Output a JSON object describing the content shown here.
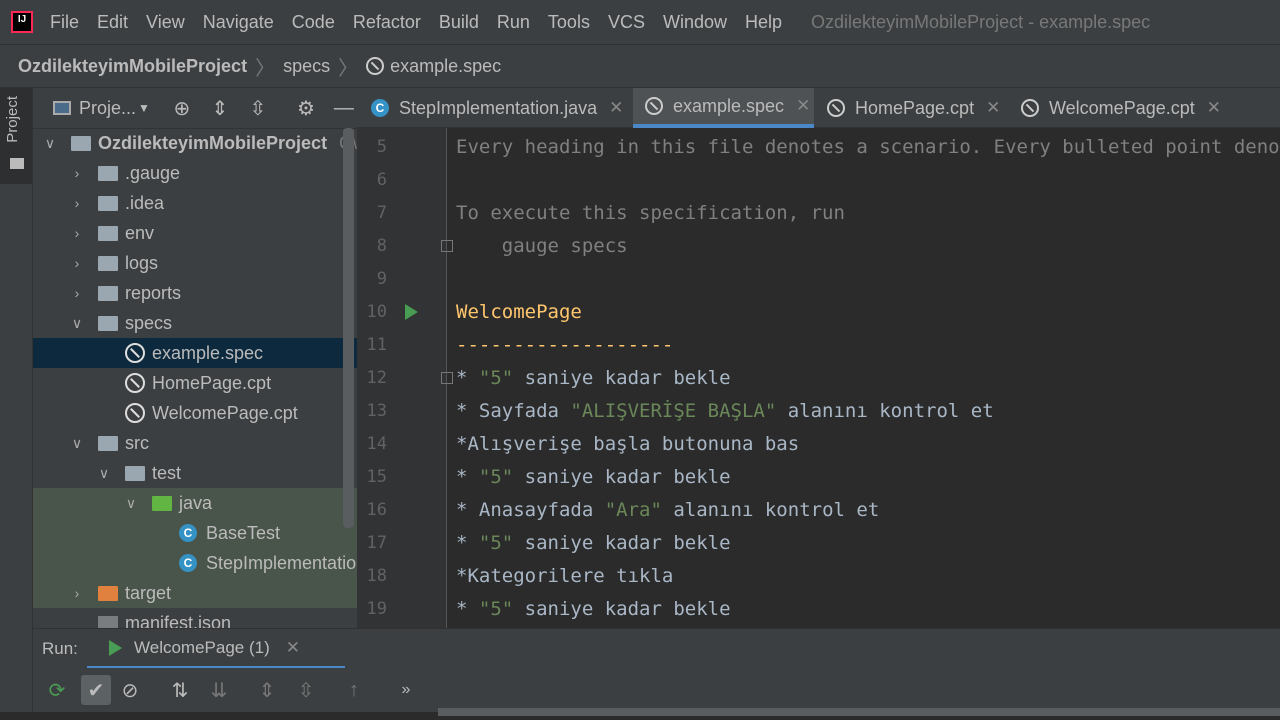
{
  "menubar": {
    "logo_text": "IJ",
    "items": [
      "File",
      "Edit",
      "View",
      "Navigate",
      "Code",
      "Refactor",
      "Build",
      "Run",
      "Tools",
      "VCS",
      "Window",
      "Help"
    ],
    "window_title": "OzdilekteyimMobileProject - example.spec"
  },
  "breadcrumb": {
    "project": "OzdilekteyimMobileProject",
    "folder": "specs",
    "file": "example.spec"
  },
  "left_strip": {
    "tab_label": "Project"
  },
  "project_panel": {
    "title": "Proje...",
    "tree": [
      {
        "label": "OzdilekteyimMobileProject",
        "suffix": "C\\"
      },
      {
        "label": ".gauge"
      },
      {
        "label": ".idea"
      },
      {
        "label": "env"
      },
      {
        "label": "logs"
      },
      {
        "label": "reports"
      },
      {
        "label": "specs"
      },
      {
        "label": "example.spec"
      },
      {
        "label": "HomePage.cpt"
      },
      {
        "label": "WelcomePage.cpt"
      },
      {
        "label": "src"
      },
      {
        "label": "test"
      },
      {
        "label": "java"
      },
      {
        "label": "BaseTest"
      },
      {
        "label": "StepImplementation"
      },
      {
        "label": "target"
      },
      {
        "label": "manifest.json"
      }
    ]
  },
  "editor_tabs": [
    {
      "label": "StepImplementation.java",
      "icon": "class-icon"
    },
    {
      "label": "example.spec",
      "icon": "gauge-icon",
      "active": true
    },
    {
      "label": "HomePage.cpt",
      "icon": "gauge-icon"
    },
    {
      "label": "WelcomePage.cpt",
      "icon": "gauge-icon"
    }
  ],
  "editor": {
    "lines": [
      {
        "n": "5",
        "parts": [
          {
            "t": "Every heading in this file denotes a scenario. Every bulleted point denotes a step.",
            "c": "comment"
          }
        ]
      },
      {
        "n": "6",
        "parts": []
      },
      {
        "n": "7",
        "parts": [
          {
            "t": "To execute this specification, run",
            "c": "comment"
          }
        ]
      },
      {
        "n": "8",
        "parts": [
          {
            "t": "    gauge specs",
            "c": "comment"
          }
        ]
      },
      {
        "n": "9",
        "parts": []
      },
      {
        "n": "10",
        "parts": [
          {
            "t": "WelcomePage",
            "c": "heading"
          }
        ]
      },
      {
        "n": "11",
        "parts": [
          {
            "t": "-------------------",
            "c": "heading"
          }
        ]
      },
      {
        "n": "12",
        "parts": [
          {
            "t": "* ",
            "c": ""
          },
          {
            "t": "\"5\"",
            "c": "str"
          },
          {
            "t": " saniye kadar bekle",
            "c": ""
          }
        ]
      },
      {
        "n": "13",
        "parts": [
          {
            "t": "* Sayfada ",
            "c": ""
          },
          {
            "t": "\"ALIŞVERİŞE BAŞLA\"",
            "c": "str"
          },
          {
            "t": " alanını kontrol et",
            "c": ""
          }
        ]
      },
      {
        "n": "14",
        "parts": [
          {
            "t": "*Alışverişe başla butonuna bas",
            "c": ""
          }
        ]
      },
      {
        "n": "15",
        "parts": [
          {
            "t": "* ",
            "c": ""
          },
          {
            "t": "\"5\"",
            "c": "str"
          },
          {
            "t": " saniye kadar bekle",
            "c": ""
          }
        ]
      },
      {
        "n": "16",
        "parts": [
          {
            "t": "* Anasayfada ",
            "c": ""
          },
          {
            "t": "\"Ara\"",
            "c": "str"
          },
          {
            "t": " alanını kontrol et",
            "c": ""
          }
        ]
      },
      {
        "n": "17",
        "parts": [
          {
            "t": "* ",
            "c": ""
          },
          {
            "t": "\"5\"",
            "c": "str"
          },
          {
            "t": " saniye kadar bekle",
            "c": ""
          }
        ]
      },
      {
        "n": "18",
        "parts": [
          {
            "t": "*Kategorilere tıkla",
            "c": ""
          }
        ]
      },
      {
        "n": "19",
        "parts": [
          {
            "t": "* ",
            "c": ""
          },
          {
            "t": "\"5\"",
            "c": "str"
          },
          {
            "t": " saniye kadar bekle",
            "c": ""
          }
        ]
      }
    ]
  },
  "run_panel": {
    "label": "Run:",
    "tab_label": "WelcomePage (1)"
  },
  "colors": {
    "accent": "#4a88c7",
    "heading": "#ffc66d",
    "string": "#6a8759",
    "comment": "#808080",
    "run_green": "#499c54"
  }
}
